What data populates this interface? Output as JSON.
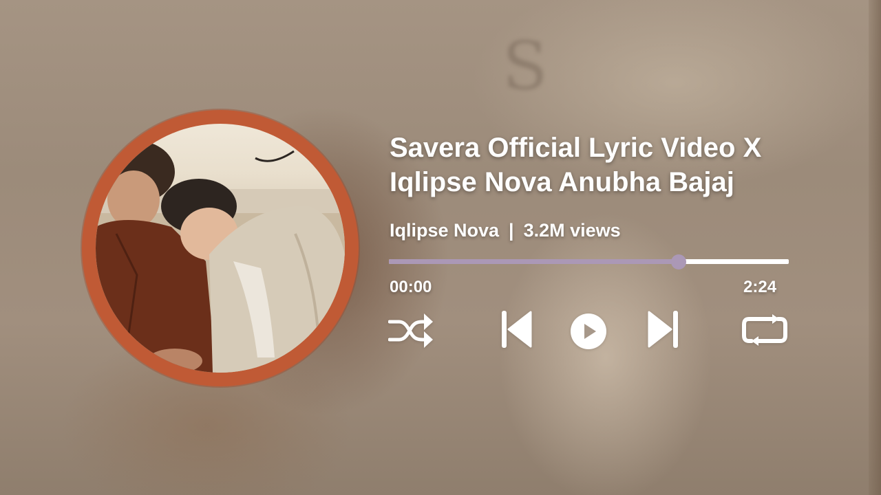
{
  "track": {
    "title_line1": "Savera Official Lyric Video X",
    "title_line2": "Iqlipse Nova Anubha Bajaj",
    "artist": "Iqlipse Nova",
    "separator": "|",
    "views": "3.2M views"
  },
  "playback": {
    "current_time": "00:00",
    "duration": "2:24",
    "progress_fraction": 0.725,
    "state": "paused"
  },
  "controls": {
    "shuffle_icon": "shuffle-icon",
    "previous_icon": "skip-previous-icon",
    "play_icon": "play-icon",
    "next_icon": "skip-next-icon",
    "repeat_icon": "repeat-icon"
  },
  "colors": {
    "progress_fill": "#ab98b6",
    "progress_track": "#ffffff",
    "art_ring": "#c05a35"
  }
}
